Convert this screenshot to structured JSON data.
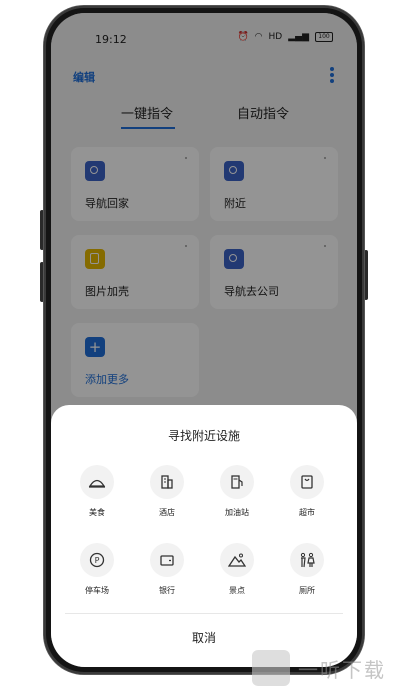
{
  "status_bar": {
    "time": "19:12",
    "hd_label": "HD",
    "battery_level": "100"
  },
  "header": {
    "edit_label": "编辑"
  },
  "tabs": [
    {
      "label": "一键指令",
      "active": true
    },
    {
      "label": "自动指令",
      "active": false
    }
  ],
  "cards": [
    {
      "label": "导航回家",
      "icon": "navigation-home-icon",
      "color": "#3b63c7"
    },
    {
      "label": "附近",
      "icon": "location-pin-icon",
      "color": "#3b63c7"
    },
    {
      "label": "图片加壳",
      "icon": "image-frame-icon",
      "color": "#e6b800"
    },
    {
      "label": "导航去公司",
      "icon": "navigation-company-icon",
      "color": "#3b63c7"
    },
    {
      "label": "添加更多",
      "icon": "plus-icon",
      "color": "#1f6fd9"
    }
  ],
  "sheet": {
    "title": "寻找附近设施",
    "options": [
      {
        "label": "美食",
        "icon": "food-cloche-icon"
      },
      {
        "label": "酒店",
        "icon": "hotel-building-icon"
      },
      {
        "label": "加油站",
        "icon": "gas-station-icon"
      },
      {
        "label": "超市",
        "icon": "supermarket-icon"
      },
      {
        "label": "停车场",
        "icon": "parking-icon"
      },
      {
        "label": "银行",
        "icon": "bank-wallet-icon"
      },
      {
        "label": "景点",
        "icon": "scenic-mountain-icon"
      },
      {
        "label": "厕所",
        "icon": "restroom-icon"
      }
    ],
    "cancel_label": "取消"
  },
  "watermark": {
    "text": "一听下载"
  },
  "colors": {
    "accent": "#1f6fd9",
    "sheet_bg": "#ffffff",
    "overlay": "rgba(0,0,0,0.42)"
  }
}
